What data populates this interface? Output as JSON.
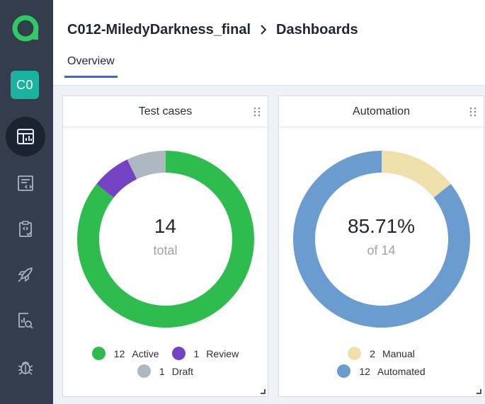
{
  "sidebar": {
    "logo_icon": "allure-logo-icon",
    "project_badge": "C0",
    "items": [
      {
        "name": "dashboards",
        "icon": "dashboard-icon",
        "active": true
      },
      {
        "name": "test-cases",
        "icon": "test-cases-icon",
        "active": false
      },
      {
        "name": "test-plans",
        "icon": "clipboard-check-icon",
        "active": false
      },
      {
        "name": "launches",
        "icon": "rocket-icon",
        "active": false
      },
      {
        "name": "analytics",
        "icon": "report-search-icon",
        "active": false
      },
      {
        "name": "defects",
        "icon": "bug-icon",
        "active": false
      }
    ]
  },
  "header": {
    "project": "C012-MiledyDarkness_final",
    "page": "Dashboards",
    "tab": "Overview"
  },
  "colors": {
    "accent": "#2f6fd0",
    "active": "#2ebc4f",
    "review": "#7443c4",
    "draft": "#aeb8c2",
    "manual": "#efdfab",
    "automated": "#6b9ccf"
  },
  "widgets": {
    "test_cases": {
      "title": "Test cases",
      "value": "14",
      "sub": "total",
      "legend": [
        {
          "count": "12",
          "label": "Active"
        },
        {
          "count": "1",
          "label": "Review"
        },
        {
          "count": "1",
          "label": "Draft"
        }
      ]
    },
    "automation": {
      "title": "Automation",
      "value": "85.71%",
      "sub": "of 14",
      "legend": [
        {
          "count": "2",
          "label": "Manual"
        },
        {
          "count": "12",
          "label": "Automated"
        }
      ]
    }
  },
  "chart_data": [
    {
      "type": "pie",
      "categories": [
        "Active",
        "Review",
        "Draft"
      ],
      "values": [
        12,
        1,
        1
      ]
    },
    {
      "type": "pie",
      "categories": [
        "Manual",
        "Automated"
      ],
      "values": [
        2,
        12
      ]
    }
  ]
}
